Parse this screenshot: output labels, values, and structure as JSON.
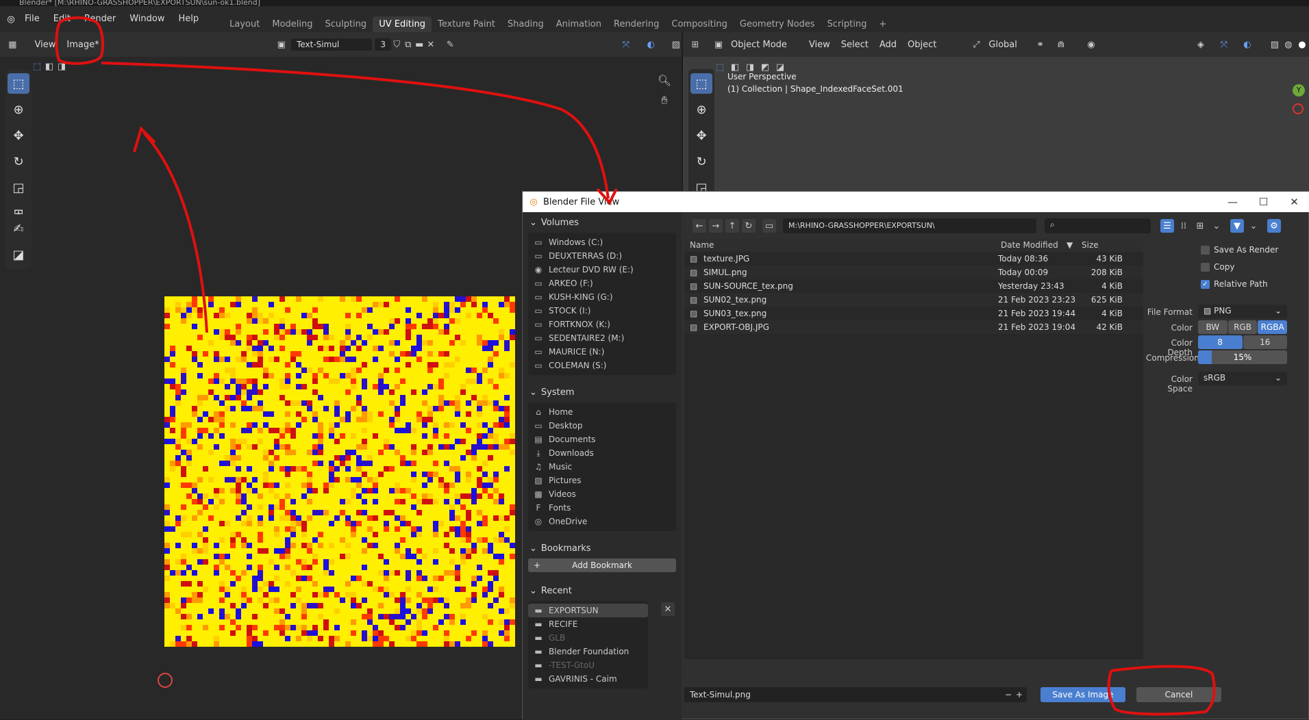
{
  "app": {
    "window_title": "Blender* [M:\\RHINO-GRASSHOPPER\\EXPORTSUN\\sun-ok1.blend]"
  },
  "topbar": {
    "menus": [
      "File",
      "Edit",
      "Render",
      "Window",
      "Help"
    ],
    "workspaces": [
      "Layout",
      "Modeling",
      "Sculpting",
      "UV Editing",
      "Texture Paint",
      "Shading",
      "Animation",
      "Rendering",
      "Compositing",
      "Geometry Nodes",
      "Scripting"
    ],
    "active_workspace": "UV Editing",
    "add_tab": "+"
  },
  "image_editor": {
    "menus": [
      "View",
      "Image*"
    ],
    "image_name": "Text-Simul",
    "user_count": "3"
  },
  "viewport": {
    "mode": "Object Mode",
    "menus": [
      "View",
      "Select",
      "Add",
      "Object"
    ],
    "orientation": "Global",
    "overlay_title": "User Perspective",
    "overlay_subtitle": "(1) Collection | Shape_IndexedFaceSet.001",
    "gizmo_y": "Y"
  },
  "dialog": {
    "title": "Blender File View",
    "path": "M:\\RHINO-GRASSHOPPER\\EXPORTSUN\\",
    "search_placeholder": "",
    "volumes_header": "Volumes",
    "volumes": [
      "Windows (C:)",
      "DEUXTERRAS (D:)",
      "Lecteur DVD RW (E:)",
      "ARKEO (F:)",
      "KUSH-KING (G:)",
      "STOCK (I:)",
      "FORTKNOX (K:)",
      "SEDENTAIRE2 (M:)",
      "MAURICE (N:)",
      "COLEMAN (S:)"
    ],
    "system_header": "System",
    "system": [
      "Home",
      "Desktop",
      "Documents",
      "Downloads",
      "Music",
      "Pictures",
      "Videos",
      "Fonts",
      "OneDrive"
    ],
    "bookmarks_header": "Bookmarks",
    "add_bookmark": "Add Bookmark",
    "recent_header": "Recent",
    "recent": [
      "EXPORTSUN",
      "RECIFE",
      "GLB",
      "Blender Foundation",
      "-TEST-GtoU",
      "GAVRINIS - Caim"
    ],
    "columns": {
      "name": "Name",
      "date": "Date Modified",
      "size": "Size"
    },
    "files": [
      {
        "name": "texture.JPG",
        "date": "Today 08:36",
        "size": "43 KiB"
      },
      {
        "name": "SIMUL.png",
        "date": "Today 00:09",
        "size": "208 KiB"
      },
      {
        "name": "SUN-SOURCE_tex.png",
        "date": "Yesterday 23:43",
        "size": "4 KiB"
      },
      {
        "name": "SUN02_tex.png",
        "date": "21 Feb 2023 23:23",
        "size": "625 KiB"
      },
      {
        "name": "SUN03_tex.png",
        "date": "21 Feb 2023 19:44",
        "size": "4 KiB"
      },
      {
        "name": "EXPORT-OBJ.JPG",
        "date": "21 Feb 2023 19:04",
        "size": "42 KiB"
      }
    ],
    "filename": "Text-Simul.png",
    "save_button": "Save As Image",
    "cancel_button": "Cancel",
    "options": {
      "save_as_render": "Save As Render",
      "copy": "Copy",
      "relative_path": "Relative Path",
      "file_format_label": "File Format",
      "file_format": "PNG",
      "color_label": "Color",
      "color_options": [
        "BW",
        "RGB",
        "RGBA"
      ],
      "color_selected": "RGBA",
      "depth_label": "Color Depth",
      "depth_options": [
        "8",
        "16"
      ],
      "depth_selected": "8",
      "compression_label": "Compression",
      "compression": "15%",
      "compression_fraction": 0.15,
      "colorspace_label": "Color Space",
      "colorspace": "sRGB"
    }
  },
  "colors": {
    "accent": "#4a7fd0",
    "annotation": "#e01010"
  }
}
